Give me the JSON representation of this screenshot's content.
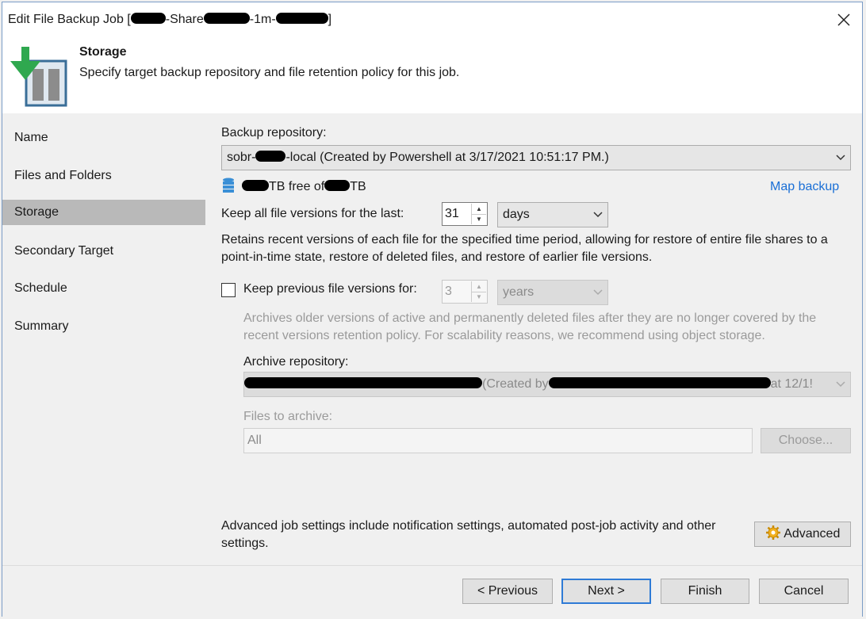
{
  "window": {
    "title_prefix": "Edit File Backup Job [",
    "title_mid1": "-Share",
    "title_mid2": "-1m-",
    "title_suffix": "]"
  },
  "header": {
    "title": "Storage",
    "description": "Specify target backup repository and file retention policy for this job.",
    "icon": "storage-download-icon",
    "accent_color": "#2fa84f"
  },
  "sidebar": {
    "items": [
      {
        "label": "Name"
      },
      {
        "label": "Files and Folders"
      },
      {
        "label": "Storage",
        "active": true
      },
      {
        "label": "Secondary Target"
      },
      {
        "label": "Schedule"
      },
      {
        "label": "Summary"
      }
    ]
  },
  "storage": {
    "repo_label": "Backup repository:",
    "repo_value_prefix": "sobr-",
    "repo_value_suffix": "-local (Created by Powershell at 3/17/2021 10:51:17 PM.)",
    "free_mid": "TB free of",
    "free_suffix": "TB",
    "map_backup": "Map backup",
    "keep_all_label": "Keep all file versions for the last:",
    "keep_all_value": "31",
    "keep_all_unit": "days",
    "keep_all_desc": "Retains recent versions of each file for the specified time period, allowing for restore of entire file shares to a point-in-time state, restore of deleted files, and restore of earlier file versions.",
    "keep_prev_label": "Keep previous file versions for:",
    "keep_prev_checked": false,
    "keep_prev_value": "3",
    "keep_prev_unit": "years",
    "keep_prev_desc": "Archives older versions of active and permanently deleted files after they are no longer covered by the recent versions retention policy. For scalability reasons, we recommend using object storage.",
    "archive_label": "Archive repository:",
    "archive_value_mid": "(Created by",
    "archive_value_suffix": "at 12/1!",
    "files_label": "Files to archive:",
    "files_value": "All",
    "choose_button": "Choose...",
    "advanced_desc": "Advanced job settings include notification settings, automated post-job activity and other settings.",
    "advanced_button": "Advanced"
  },
  "footer": {
    "previous": "< Previous",
    "next": "Next >",
    "finish": "Finish",
    "cancel": "Cancel"
  }
}
